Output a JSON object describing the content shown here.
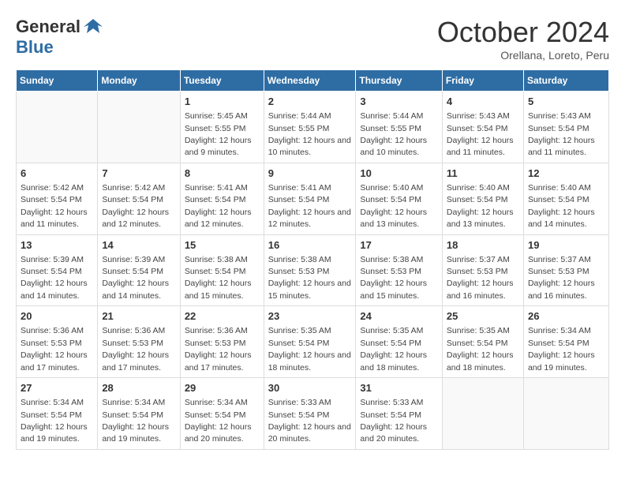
{
  "header": {
    "logo_general": "General",
    "logo_blue": "Blue",
    "month_title": "October 2024",
    "subtitle": "Orellana, Loreto, Peru"
  },
  "weekdays": [
    "Sunday",
    "Monday",
    "Tuesday",
    "Wednesday",
    "Thursday",
    "Friday",
    "Saturday"
  ],
  "weeks": [
    [
      {
        "day": null
      },
      {
        "day": null
      },
      {
        "day": "1",
        "sunrise": "Sunrise: 5:45 AM",
        "sunset": "Sunset: 5:55 PM",
        "daylight": "Daylight: 12 hours and 9 minutes."
      },
      {
        "day": "2",
        "sunrise": "Sunrise: 5:44 AM",
        "sunset": "Sunset: 5:55 PM",
        "daylight": "Daylight: 12 hours and 10 minutes."
      },
      {
        "day": "3",
        "sunrise": "Sunrise: 5:44 AM",
        "sunset": "Sunset: 5:55 PM",
        "daylight": "Daylight: 12 hours and 10 minutes."
      },
      {
        "day": "4",
        "sunrise": "Sunrise: 5:43 AM",
        "sunset": "Sunset: 5:54 PM",
        "daylight": "Daylight: 12 hours and 11 minutes."
      },
      {
        "day": "5",
        "sunrise": "Sunrise: 5:43 AM",
        "sunset": "Sunset: 5:54 PM",
        "daylight": "Daylight: 12 hours and 11 minutes."
      }
    ],
    [
      {
        "day": "6",
        "sunrise": "Sunrise: 5:42 AM",
        "sunset": "Sunset: 5:54 PM",
        "daylight": "Daylight: 12 hours and 11 minutes."
      },
      {
        "day": "7",
        "sunrise": "Sunrise: 5:42 AM",
        "sunset": "Sunset: 5:54 PM",
        "daylight": "Daylight: 12 hours and 12 minutes."
      },
      {
        "day": "8",
        "sunrise": "Sunrise: 5:41 AM",
        "sunset": "Sunset: 5:54 PM",
        "daylight": "Daylight: 12 hours and 12 minutes."
      },
      {
        "day": "9",
        "sunrise": "Sunrise: 5:41 AM",
        "sunset": "Sunset: 5:54 PM",
        "daylight": "Daylight: 12 hours and 12 minutes."
      },
      {
        "day": "10",
        "sunrise": "Sunrise: 5:40 AM",
        "sunset": "Sunset: 5:54 PM",
        "daylight": "Daylight: 12 hours and 13 minutes."
      },
      {
        "day": "11",
        "sunrise": "Sunrise: 5:40 AM",
        "sunset": "Sunset: 5:54 PM",
        "daylight": "Daylight: 12 hours and 13 minutes."
      },
      {
        "day": "12",
        "sunrise": "Sunrise: 5:40 AM",
        "sunset": "Sunset: 5:54 PM",
        "daylight": "Daylight: 12 hours and 14 minutes."
      }
    ],
    [
      {
        "day": "13",
        "sunrise": "Sunrise: 5:39 AM",
        "sunset": "Sunset: 5:54 PM",
        "daylight": "Daylight: 12 hours and 14 minutes."
      },
      {
        "day": "14",
        "sunrise": "Sunrise: 5:39 AM",
        "sunset": "Sunset: 5:54 PM",
        "daylight": "Daylight: 12 hours and 14 minutes."
      },
      {
        "day": "15",
        "sunrise": "Sunrise: 5:38 AM",
        "sunset": "Sunset: 5:54 PM",
        "daylight": "Daylight: 12 hours and 15 minutes."
      },
      {
        "day": "16",
        "sunrise": "Sunrise: 5:38 AM",
        "sunset": "Sunset: 5:53 PM",
        "daylight": "Daylight: 12 hours and 15 minutes."
      },
      {
        "day": "17",
        "sunrise": "Sunrise: 5:38 AM",
        "sunset": "Sunset: 5:53 PM",
        "daylight": "Daylight: 12 hours and 15 minutes."
      },
      {
        "day": "18",
        "sunrise": "Sunrise: 5:37 AM",
        "sunset": "Sunset: 5:53 PM",
        "daylight": "Daylight: 12 hours and 16 minutes."
      },
      {
        "day": "19",
        "sunrise": "Sunrise: 5:37 AM",
        "sunset": "Sunset: 5:53 PM",
        "daylight": "Daylight: 12 hours and 16 minutes."
      }
    ],
    [
      {
        "day": "20",
        "sunrise": "Sunrise: 5:36 AM",
        "sunset": "Sunset: 5:53 PM",
        "daylight": "Daylight: 12 hours and 17 minutes."
      },
      {
        "day": "21",
        "sunrise": "Sunrise: 5:36 AM",
        "sunset": "Sunset: 5:53 PM",
        "daylight": "Daylight: 12 hours and 17 minutes."
      },
      {
        "day": "22",
        "sunrise": "Sunrise: 5:36 AM",
        "sunset": "Sunset: 5:53 PM",
        "daylight": "Daylight: 12 hours and 17 minutes."
      },
      {
        "day": "23",
        "sunrise": "Sunrise: 5:35 AM",
        "sunset": "Sunset: 5:54 PM",
        "daylight": "Daylight: 12 hours and 18 minutes."
      },
      {
        "day": "24",
        "sunrise": "Sunrise: 5:35 AM",
        "sunset": "Sunset: 5:54 PM",
        "daylight": "Daylight: 12 hours and 18 minutes."
      },
      {
        "day": "25",
        "sunrise": "Sunrise: 5:35 AM",
        "sunset": "Sunset: 5:54 PM",
        "daylight": "Daylight: 12 hours and 18 minutes."
      },
      {
        "day": "26",
        "sunrise": "Sunrise: 5:34 AM",
        "sunset": "Sunset: 5:54 PM",
        "daylight": "Daylight: 12 hours and 19 minutes."
      }
    ],
    [
      {
        "day": "27",
        "sunrise": "Sunrise: 5:34 AM",
        "sunset": "Sunset: 5:54 PM",
        "daylight": "Daylight: 12 hours and 19 minutes."
      },
      {
        "day": "28",
        "sunrise": "Sunrise: 5:34 AM",
        "sunset": "Sunset: 5:54 PM",
        "daylight": "Daylight: 12 hours and 19 minutes."
      },
      {
        "day": "29",
        "sunrise": "Sunrise: 5:34 AM",
        "sunset": "Sunset: 5:54 PM",
        "daylight": "Daylight: 12 hours and 20 minutes."
      },
      {
        "day": "30",
        "sunrise": "Sunrise: 5:33 AM",
        "sunset": "Sunset: 5:54 PM",
        "daylight": "Daylight: 12 hours and 20 minutes."
      },
      {
        "day": "31",
        "sunrise": "Sunrise: 5:33 AM",
        "sunset": "Sunset: 5:54 PM",
        "daylight": "Daylight: 12 hours and 20 minutes."
      },
      {
        "day": null
      },
      {
        "day": null
      }
    ]
  ]
}
